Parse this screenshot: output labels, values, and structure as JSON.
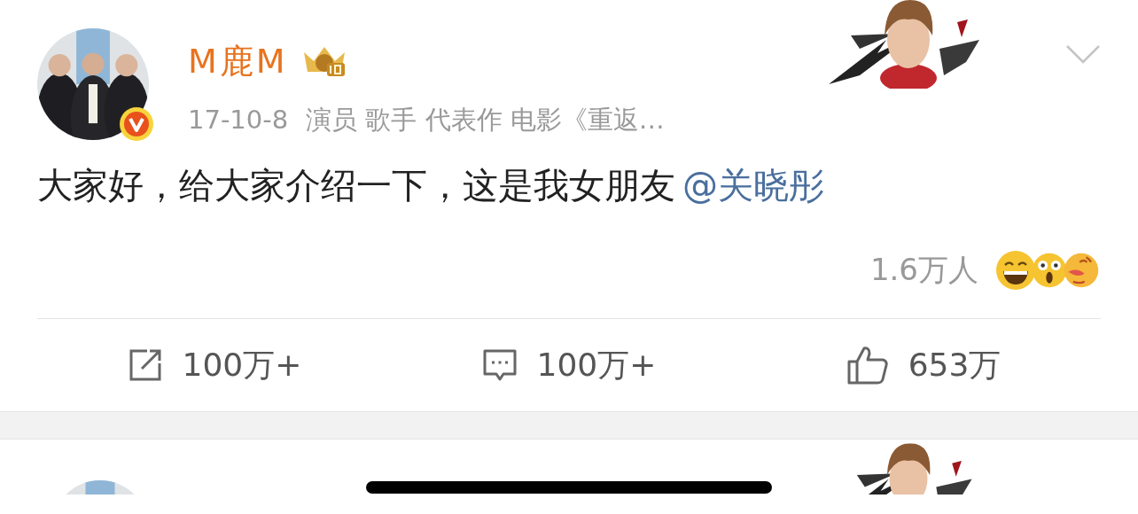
{
  "post": {
    "author": {
      "name": "M鹿M",
      "verified": true
    },
    "time": "17-10-8",
    "description": "演员 歌手 代表作 电影《重返…",
    "text": "大家好，给大家介绍一下，这是我女朋友",
    "mention": "@关晓彤",
    "reaction_count": "1.6万人",
    "actions": [
      {
        "kind": "share",
        "count": "100万+"
      },
      {
        "kind": "comment",
        "count": "100万+"
      },
      {
        "kind": "like",
        "count": "653万"
      }
    ]
  }
}
